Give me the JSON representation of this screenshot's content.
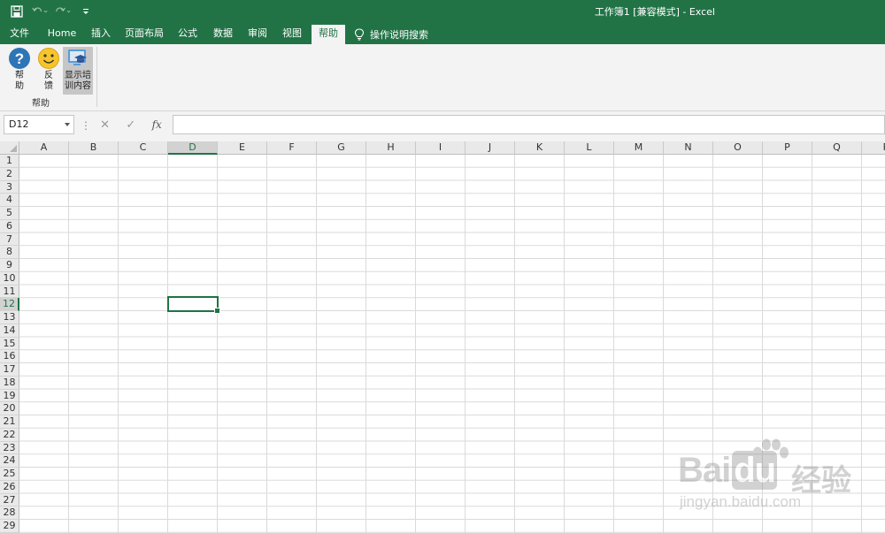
{
  "title_bar": {
    "title": "工作簿1  [兼容模式]  -  Excel",
    "qat": [
      "save-icon",
      "undo-icon",
      "redo-icon",
      "customize-qat-icon"
    ]
  },
  "ribbon_tabs": [
    "文件",
    "Home",
    "插入",
    "页面布局",
    "公式",
    "数据",
    "审阅",
    "视图",
    "帮助"
  ],
  "active_tab": "帮助",
  "tell_me": {
    "icon": "lightbulb-icon",
    "label": "操作说明搜索"
  },
  "ribbon_group": {
    "label": "帮助",
    "buttons": [
      {
        "label_line1": "帮",
        "label_line2": "助",
        "icon": "help-icon"
      },
      {
        "label_line1": "反",
        "label_line2": "馈",
        "icon": "smiley-icon"
      },
      {
        "label_line1": "显示培",
        "label_line2": "训内容",
        "icon": "training-icon",
        "selected": true
      }
    ]
  },
  "formula_bar": {
    "name_box": "D12",
    "cancel": "✕",
    "enter": "✓",
    "fx": "fx",
    "formula": ""
  },
  "grid": {
    "columns": [
      "A",
      "B",
      "C",
      "D",
      "E",
      "F",
      "G",
      "H",
      "I",
      "J",
      "K",
      "L",
      "M",
      "N",
      "O",
      "P",
      "Q",
      "R"
    ],
    "rows": [
      1,
      2,
      3,
      4,
      5,
      6,
      7,
      8,
      9,
      10,
      11,
      12,
      13,
      14,
      15,
      16,
      17,
      18,
      19,
      20,
      21,
      22,
      23,
      24,
      25,
      26,
      27,
      28,
      29
    ],
    "selected_column": "D",
    "selected_row": 12
  },
  "watermark": {
    "brand": "Bai",
    "brand2": "du",
    "cn": "经验",
    "url": "jingyan.baidu.com"
  },
  "colors": {
    "excel_green": "#217346",
    "ribbon_bg": "#f3f3f3"
  }
}
